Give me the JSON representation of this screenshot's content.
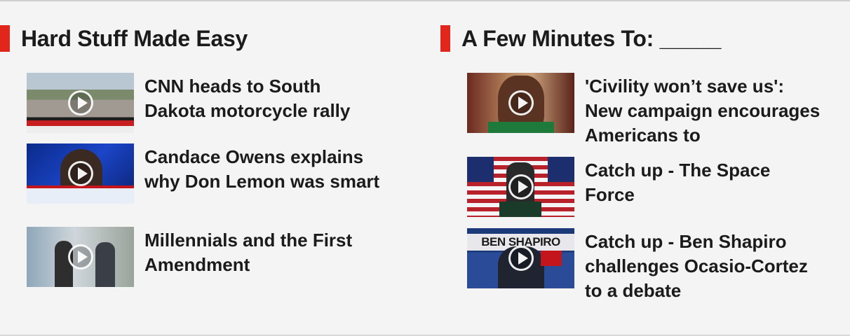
{
  "sections": [
    {
      "title": "Hard Stuff Made Easy",
      "accent_color": "#e1261c",
      "items": [
        {
          "title": "CNN heads to South Dakota motorcycle rally",
          "icon": "play-icon"
        },
        {
          "title": "Candace Owens explains why Don Lemon was smart",
          "icon": "play-icon"
        },
        {
          "title": "Millennials and the First Amendment",
          "icon": "play-icon"
        }
      ]
    },
    {
      "title": "A Few Minutes To: _____",
      "accent_color": "#e1261c",
      "items": [
        {
          "title": "'Civility won’t save us': New campaign encourages Americans to",
          "icon": "play-icon"
        },
        {
          "title": "Catch up - The Space Force",
          "icon": "play-icon"
        },
        {
          "title": "Catch up - Ben Shapiro challenges Ocasio-Cortez to a debate",
          "icon": "play-icon",
          "thumb_text": "BEN SHAPIRO"
        }
      ]
    }
  ]
}
